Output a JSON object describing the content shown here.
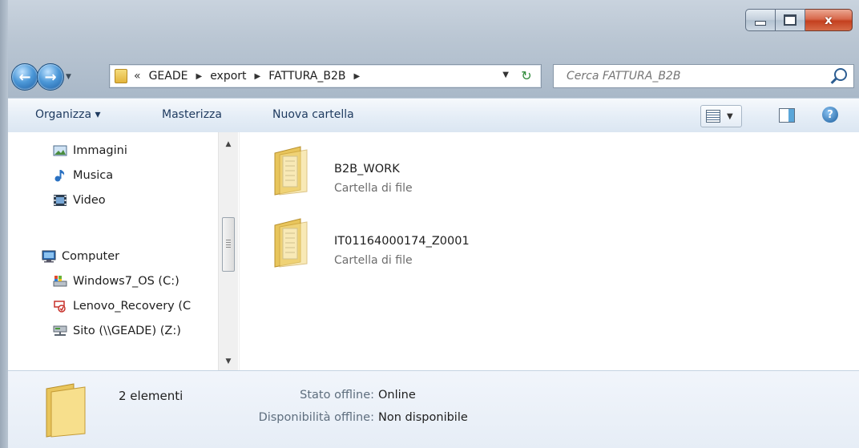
{
  "nav": {
    "breadcrumb_overflow": "«",
    "breadcrumb": [
      "GEADE",
      "export",
      "FATTURA_B2B"
    ],
    "search_placeholder": "Cerca FATTURA_B2B"
  },
  "caption": {
    "close_glyph": "x"
  },
  "commandbar": {
    "organize": "Organizza ▾",
    "burn": "Masterizza",
    "new_folder": "Nuova cartella",
    "help": "?"
  },
  "navpane": {
    "items": [
      {
        "label": "Immagini",
        "icon": "pictures-icon"
      },
      {
        "label": "Musica",
        "icon": "music-icon"
      },
      {
        "label": "Video",
        "icon": "video-icon"
      },
      {
        "label": "Computer",
        "icon": "computer-icon"
      },
      {
        "label": "Windows7_OS (C:)",
        "icon": "drive-icon"
      },
      {
        "label": "Lenovo_Recovery (C",
        "icon": "recovery-drive-icon"
      },
      {
        "label": "Sito (\\\\GEADE) (Z:)",
        "icon": "network-drive-icon"
      }
    ]
  },
  "files": [
    {
      "name": "B2B_WORK",
      "type": "Cartella di file"
    },
    {
      "name": "IT01164000174_Z0001",
      "type": "Cartella di file"
    }
  ],
  "details": {
    "count": "2 elementi",
    "status_label": "Stato offline:",
    "status_value": "Online",
    "availability_label": "Disponibilità offline:",
    "availability_value": "Non disponibile"
  },
  "colors": {
    "frame": "#bac6d3",
    "close_button": "#c4401f",
    "commandbar": "#e6eef7",
    "details_pane": "#e6edf6"
  }
}
